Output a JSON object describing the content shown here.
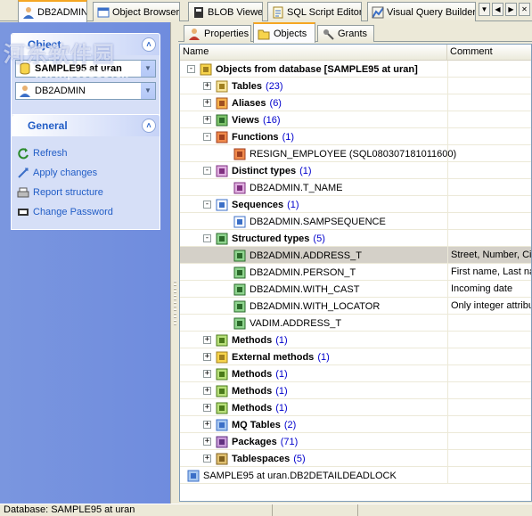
{
  "doc_tabs": [
    {
      "label": "DB2ADMIN",
      "icon": "user-icon",
      "active": true
    },
    {
      "label": "Object Browser",
      "icon": "object-browser-icon",
      "active": false
    },
    {
      "label": "BLOB Viewer",
      "icon": "blob-viewer-icon",
      "active": false
    },
    {
      "label": "SQL Script Editor",
      "icon": "sql-script-icon",
      "active": false
    },
    {
      "label": "Visual Query Builder",
      "icon": "query-builder-icon",
      "active": false
    }
  ],
  "watermark": {
    "text_cn": "河东软件园",
    "url": "www.pc0359.cn"
  },
  "object_panel": {
    "title": "Object",
    "database": "SAMPLE95 at uran",
    "schema": "DB2ADMIN"
  },
  "general_panel": {
    "title": "General",
    "links": [
      {
        "label": "Refresh",
        "icon": "refresh-icon"
      },
      {
        "label": "Apply changes",
        "icon": "apply-icon"
      },
      {
        "label": "Report structure",
        "icon": "report-icon"
      },
      {
        "label": "Change Password",
        "icon": "password-icon"
      }
    ]
  },
  "sub_tabs": [
    {
      "label": "Properties",
      "icon": "properties-icon",
      "active": false
    },
    {
      "label": "Objects",
      "icon": "objects-icon",
      "active": true
    },
    {
      "label": "Grants",
      "icon": "grants-icon",
      "active": false
    }
  ],
  "grid": {
    "columns": [
      "Name",
      "Comment"
    ],
    "rows": [
      {
        "label": "Objects from database [SAMPLE95 at uran]",
        "count": "",
        "comment": "",
        "level": 0,
        "expander": "-",
        "bold": true,
        "icon": "database-icon"
      },
      {
        "label": "Tables",
        "count": "(23)",
        "comment": "",
        "level": 1,
        "expander": "+",
        "bold": true,
        "icon": "tables-icon"
      },
      {
        "label": "Aliases",
        "count": "(6)",
        "comment": "",
        "level": 1,
        "expander": "+",
        "bold": true,
        "icon": "aliases-icon"
      },
      {
        "label": "Views",
        "count": "(16)",
        "comment": "",
        "level": 1,
        "expander": "+",
        "bold": true,
        "icon": "views-icon"
      },
      {
        "label": "Functions",
        "count": "(1)",
        "comment": "",
        "level": 1,
        "expander": "-",
        "bold": true,
        "icon": "functions-icon"
      },
      {
        "label": "RESIGN_EMPLOYEE (SQL080307181011600)",
        "count": "",
        "comment": "",
        "level": 2,
        "expander": "",
        "bold": false,
        "icon": "function-icon"
      },
      {
        "label": "Distinct types",
        "count": "(1)",
        "comment": "",
        "level": 1,
        "expander": "-",
        "bold": true,
        "icon": "distinct-types-icon"
      },
      {
        "label": "DB2ADMIN.T_NAME",
        "count": "",
        "comment": "",
        "level": 2,
        "expander": "",
        "bold": false,
        "icon": "distinct-type-icon"
      },
      {
        "label": "Sequences",
        "count": "(1)",
        "comment": "",
        "level": 1,
        "expander": "-",
        "bold": true,
        "icon": "sequences-icon"
      },
      {
        "label": "DB2ADMIN.SAMPSEQUENCE",
        "count": "",
        "comment": "",
        "level": 2,
        "expander": "",
        "bold": false,
        "icon": "sequence-icon"
      },
      {
        "label": "Structured types",
        "count": "(5)",
        "comment": "",
        "level": 1,
        "expander": "-",
        "bold": true,
        "icon": "structured-types-icon"
      },
      {
        "label": "DB2ADMIN.ADDRESS_T",
        "count": "",
        "comment": "Street, Number, Ci",
        "level": 2,
        "expander": "",
        "bold": false,
        "icon": "structured-type-icon",
        "selected": true
      },
      {
        "label": "DB2ADMIN.PERSON_T",
        "count": "",
        "comment": "First name, Last na",
        "level": 2,
        "expander": "",
        "bold": false,
        "icon": "structured-type-icon"
      },
      {
        "label": "DB2ADMIN.WITH_CAST",
        "count": "",
        "comment": "Incoming date",
        "level": 2,
        "expander": "",
        "bold": false,
        "icon": "structured-type-icon"
      },
      {
        "label": "DB2ADMIN.WITH_LOCATOR",
        "count": "",
        "comment": "Only integer attribu",
        "level": 2,
        "expander": "",
        "bold": false,
        "icon": "structured-type-icon"
      },
      {
        "label": "VADIM.ADDRESS_T",
        "count": "",
        "comment": "",
        "level": 2,
        "expander": "",
        "bold": false,
        "icon": "structured-type-icon"
      },
      {
        "label": "Methods",
        "count": "(1)",
        "comment": "",
        "level": 1,
        "expander": "+",
        "bold": true,
        "icon": "methods-icon"
      },
      {
        "label": "External methods",
        "count": "(1)",
        "comment": "",
        "level": 1,
        "expander": "+",
        "bold": true,
        "icon": "external-methods-icon"
      },
      {
        "label": "Methods",
        "count": "(1)",
        "comment": "",
        "level": 1,
        "expander": "+",
        "bold": true,
        "icon": "methods-icon"
      },
      {
        "label": "Methods",
        "count": "(1)",
        "comment": "",
        "level": 1,
        "expander": "+",
        "bold": true,
        "icon": "methods-icon"
      },
      {
        "label": "Methods",
        "count": "(1)",
        "comment": "",
        "level": 1,
        "expander": "+",
        "bold": true,
        "icon": "methods-icon"
      },
      {
        "label": "MQ Tables",
        "count": "(2)",
        "comment": "",
        "level": 1,
        "expander": "+",
        "bold": true,
        "icon": "mq-tables-icon"
      },
      {
        "label": "Packages",
        "count": "(71)",
        "comment": "",
        "level": 1,
        "expander": "+",
        "bold": true,
        "icon": "packages-icon"
      },
      {
        "label": "Tablespaces",
        "count": "(5)",
        "comment": "",
        "level": 1,
        "expander": "+",
        "bold": true,
        "icon": "tablespaces-icon"
      },
      {
        "label": "SAMPLE95 at uran.DB2DETAILDEADLOCK",
        "count": "",
        "comment": "",
        "level": 0,
        "expander": "",
        "bold": false,
        "icon": "event-monitor-icon"
      }
    ]
  },
  "status": {
    "database": "Database: SAMPLE95 at uran"
  },
  "colors": {
    "accent": "#215dc6",
    "panel": "#7a96df",
    "count": "#0000cc",
    "tab_highlight": "#f5a623"
  }
}
